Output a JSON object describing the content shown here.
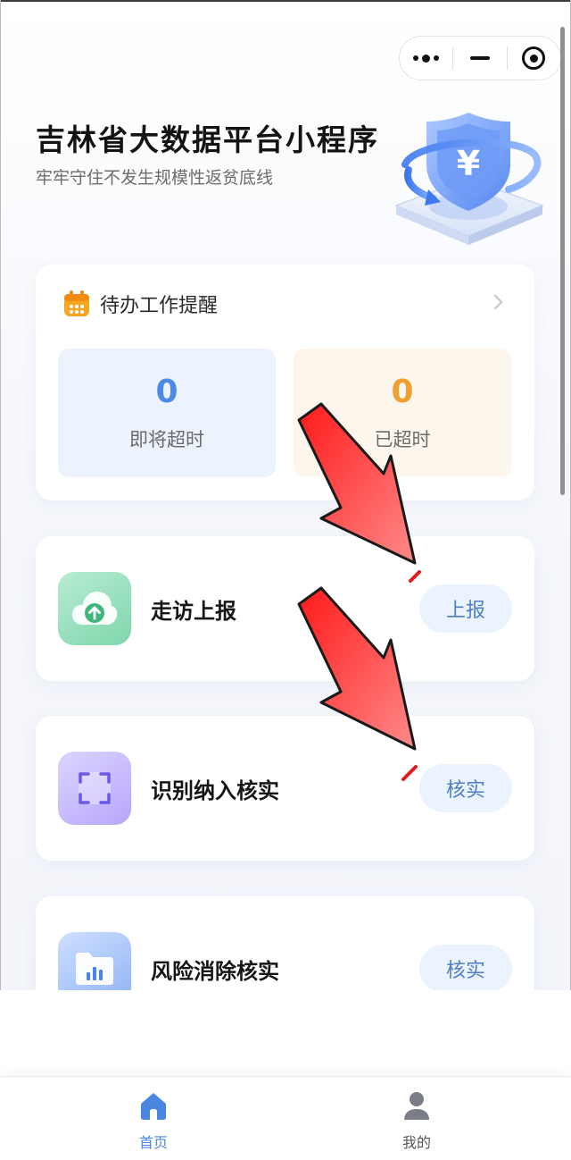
{
  "page": {
    "title": "吉林省大数据平台小程序",
    "subtitle": "牢牢守住不发生规模性返贫底线"
  },
  "capsule": {
    "menu_icon": "more-dots-icon",
    "minimize_icon": "minimize-icon",
    "close_icon": "target-close-icon"
  },
  "todo": {
    "title": "待办工作提醒",
    "icon": "calendar-icon",
    "stats": [
      {
        "value": "0",
        "label": "即将超时",
        "color": "#4c8ae8"
      },
      {
        "value": "0",
        "label": "已超时",
        "color": "#f0a030"
      }
    ]
  },
  "tasks": [
    {
      "name": "走访上报",
      "button": "上报",
      "icon": "cloud-upload-icon"
    },
    {
      "name": "识别纳入核实",
      "button": "核实",
      "icon": "scan-frame-icon"
    },
    {
      "name": "风险消除核实",
      "button": "核实",
      "icon": "folder-chart-icon"
    }
  ],
  "tabbar": [
    {
      "label": "首页",
      "icon": "home-icon",
      "active": true,
      "color": "#4a86e0"
    },
    {
      "label": "我的",
      "icon": "user-icon",
      "active": false,
      "color": "#555555"
    }
  ],
  "colors": {
    "accent": "#4a86e0",
    "button_bg": "#ebf3fe",
    "annotation_arrow": "#f03030"
  }
}
